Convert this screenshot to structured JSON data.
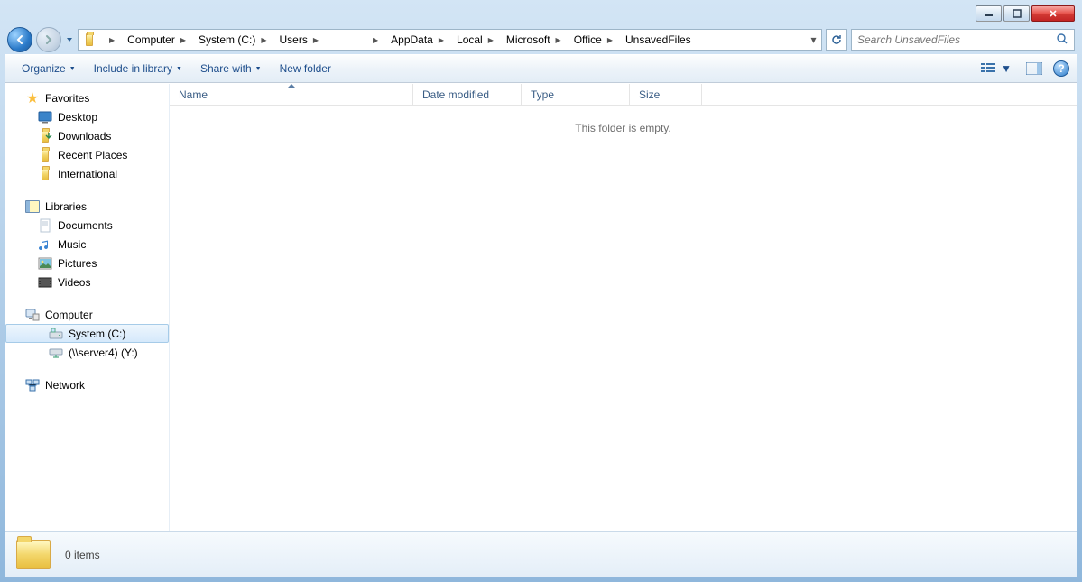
{
  "breadcrumb": [
    "Computer",
    "System (C:)",
    "Users",
    "",
    "AppData",
    "Local",
    "Microsoft",
    "Office",
    "UnsavedFiles"
  ],
  "search_placeholder": "Search UnsavedFiles",
  "cmdbar": {
    "organize": "Organize",
    "include": "Include in library",
    "share": "Share with",
    "newfolder": "New folder"
  },
  "nav": {
    "favorites": {
      "label": "Favorites",
      "items": [
        "Desktop",
        "Downloads",
        "Recent Places",
        "International"
      ]
    },
    "libraries": {
      "label": "Libraries",
      "items": [
        "Documents",
        "Music",
        "Pictures",
        "Videos"
      ]
    },
    "computer": {
      "label": "Computer",
      "items": [
        "System (C:)",
        "(\\\\server4) (Y:)"
      ]
    },
    "network": {
      "label": "Network"
    }
  },
  "columns": {
    "name": "Name",
    "modified": "Date modified",
    "type": "Type",
    "size": "Size"
  },
  "empty_message": "This folder is empty.",
  "details": {
    "count": "0 items"
  }
}
